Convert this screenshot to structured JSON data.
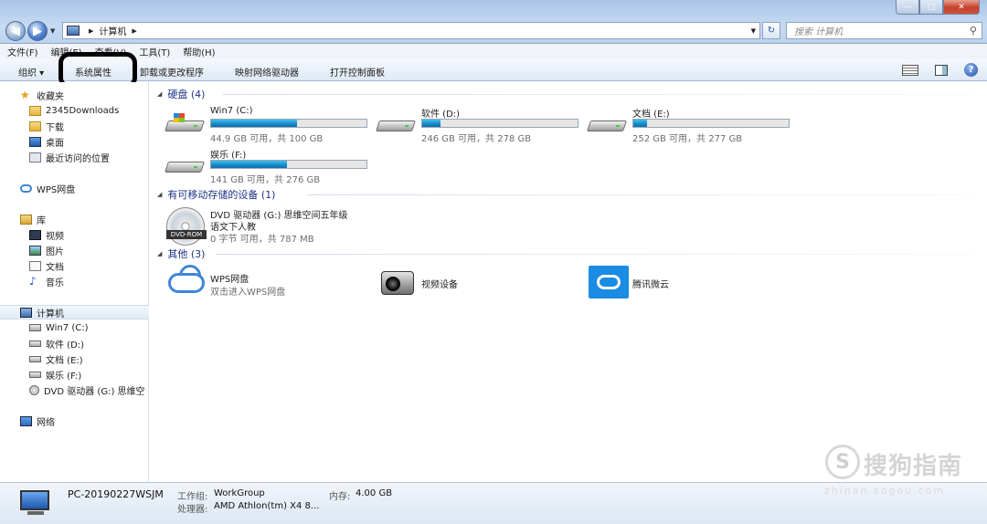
{
  "window": {
    "address_path": "计算机",
    "search_placeholder": "搜索 计算机",
    "controls": {
      "minimize": "—",
      "maximize": "□",
      "close": "✕"
    }
  },
  "menu": [
    "文件(F)",
    "编辑(E)",
    "查看(V)",
    "工具(T)",
    "帮助(H)"
  ],
  "command_bar": {
    "organize": "组织 ▾",
    "system_properties": "系统属性",
    "uninstall": "卸载或更改程序",
    "map_drive": "映射网络驱动器",
    "control_panel": "打开控制面板"
  },
  "sidebar": {
    "favorites": "收藏夹",
    "fav_items": [
      "2345Downloads",
      "下载",
      "桌面",
      "最近访问的位置"
    ],
    "wps": "WPS网盘",
    "library": "库",
    "lib_items": [
      "视频",
      "图片",
      "文档",
      "音乐"
    ],
    "computer": "计算机",
    "comp_items": [
      "Win7 (C:)",
      "软件 (D:)",
      "文档 (E:)",
      "娱乐 (F:)",
      "DVD 驱动器 (G:) 思维空"
    ],
    "network": "网络"
  },
  "groups": {
    "hdd": "硬盘 (4)",
    "removable": "有可移动存储的设备 (1)",
    "other": "其他 (3)"
  },
  "drives": [
    {
      "name": "Win7 (C:)",
      "free": "44.9 GB 可用，共 100 GB",
      "used_pct": 55
    },
    {
      "name": "软件 (D:)",
      "free": "246 GB 可用，共 278 GB",
      "used_pct": 12
    },
    {
      "name": "文档 (E:)",
      "free": "252 GB 可用，共 277 GB",
      "used_pct": 9
    },
    {
      "name": "娱乐 (F:)",
      "free": "141 GB 可用，共 276 GB",
      "used_pct": 49
    }
  ],
  "dvd": {
    "name": "DVD 驱动器 (G:) 思维空间五年级",
    "name2": "语文下人教",
    "free": "0 字节 可用，共 787 MB",
    "label": "DVD-ROM"
  },
  "others": [
    {
      "name": "WPS网盘",
      "sub": "双击进入WPS网盘"
    },
    {
      "name": "视频设备",
      "sub": ""
    },
    {
      "name": "腾讯微云",
      "sub": ""
    }
  ],
  "details": {
    "pc_name": "PC-20190227WSJM",
    "workgroup_label": "工作组:",
    "workgroup": "WorkGroup",
    "memory_label": "内存:",
    "memory": "4.00 GB",
    "cpu_label": "处理器:",
    "cpu": "AMD Athlon(tm) X4 8..."
  },
  "watermark": {
    "logo": "S",
    "text": "搜狗指南",
    "url": "zhinan.sogou.com"
  },
  "colors": {
    "accent": "#1e3287",
    "bar": "#1688c8",
    "highlight_ring": "#000000"
  }
}
